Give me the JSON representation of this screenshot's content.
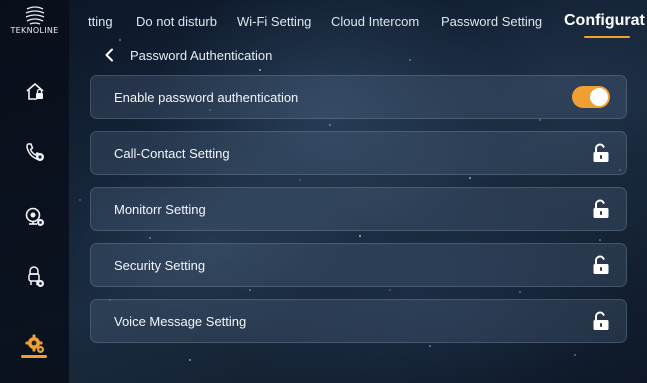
{
  "sidebar": {
    "logo_text": "TEKNOLINE",
    "items": [
      {
        "icon": "home-lock-icon"
      },
      {
        "icon": "phone-contact-icon"
      },
      {
        "icon": "monitor-camera-icon"
      },
      {
        "icon": "security-guard-icon"
      },
      {
        "icon": "settings-gear-icon",
        "active": true
      }
    ],
    "accent": "#f0a030"
  },
  "topnav": {
    "tabs": [
      {
        "label": "tting"
      },
      {
        "label": "Do not disturb"
      },
      {
        "label": "Wi-Fi Setting"
      },
      {
        "label": "Cloud Intercom"
      },
      {
        "label": "Password Setting"
      },
      {
        "label": "Configurat",
        "active": true
      }
    ]
  },
  "breadcrumb": {
    "title": "Password Authentication"
  },
  "settings": {
    "enable_row": {
      "label": "Enable password authentication",
      "enabled": true
    },
    "items": [
      {
        "label": "Call-Contact Setting",
        "icon": "unlock-icon"
      },
      {
        "label": "Monitorr Setting",
        "icon": "unlock-icon"
      },
      {
        "label": "Security Setting",
        "icon": "unlock-icon"
      },
      {
        "label": "Voice Message Setting",
        "icon": "unlock-icon"
      }
    ]
  },
  "colors": {
    "accent": "#f0a030",
    "row_bg": "rgba(90,110,140,0.28)",
    "text": "#ffffff"
  }
}
